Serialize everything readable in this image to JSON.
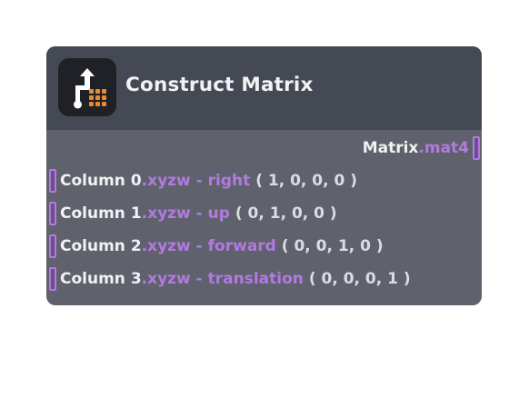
{
  "node": {
    "title": "Construct Matrix",
    "icon": "construct-matrix-icon",
    "output": {
      "name": "Matrix",
      "type": ".mat4"
    },
    "inputs": [
      {
        "name": "Column 0",
        "type": ".xyzw - right",
        "default": "( 1, 0, 0, 0 )"
      },
      {
        "name": "Column 1",
        "type": ".xyzw - up",
        "default": "( 0, 1, 0, 0 )"
      },
      {
        "name": "Column 2",
        "type": ".xyzw - forward",
        "default": "( 0, 0, 1, 0 )"
      },
      {
        "name": "Column 3",
        "type": ".xyzw - translation",
        "default": "( 0, 0, 0, 1 )"
      }
    ]
  },
  "colors": {
    "header": "#454953",
    "body": "#5f626c",
    "accent": "#b27ae0",
    "icon_bg": "#1f2126",
    "icon_grid": "#e88a2f"
  }
}
